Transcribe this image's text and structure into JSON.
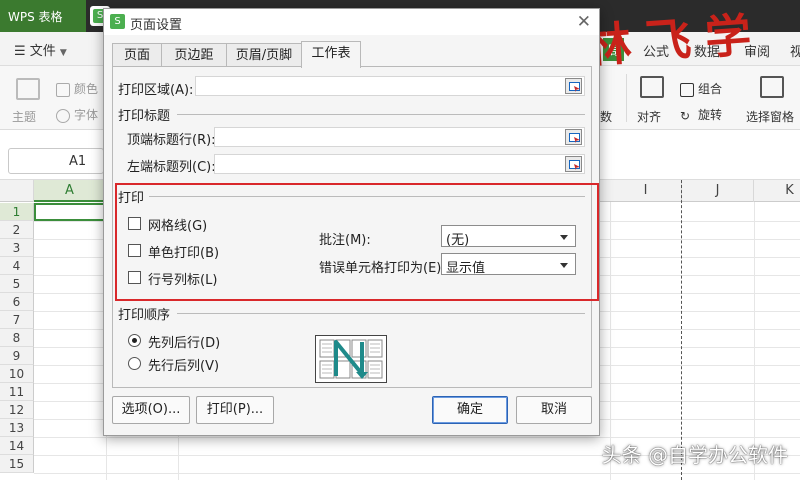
{
  "app": {
    "tab_title": "WPS 表格",
    "menu_label": "文件",
    "ribbon_tabs": [
      {
        "label": "局",
        "active": true
      },
      {
        "label": "公式"
      },
      {
        "label": "数据"
      },
      {
        "label": "审阅"
      },
      {
        "label": "视"
      }
    ],
    "ribbon_left": [
      {
        "label": "颜色"
      },
      {
        "label": "主题"
      },
      {
        "label": "字体"
      }
    ],
    "ribbon_right": [
      {
        "label": "组合"
      },
      {
        "label": "对齐"
      },
      {
        "label": "旋转"
      },
      {
        "label": "选择窗格"
      },
      {
        "label": "数"
      }
    ],
    "name_box": "A1",
    "columns": [
      "A",
      "I",
      "J",
      "K"
    ],
    "rows": [
      "1",
      "2",
      "3",
      "4",
      "5",
      "6",
      "7",
      "8",
      "9",
      "10",
      "11",
      "12",
      "13",
      "14",
      "15"
    ]
  },
  "overlay": {
    "calligraphy": "林飞学",
    "watermark": "头条 @自学办公软件"
  },
  "dialog": {
    "title": "页面设置",
    "tabs": [
      {
        "label": "页面"
      },
      {
        "label": "页边距"
      },
      {
        "label": "页眉/页脚"
      },
      {
        "label": "工作表",
        "active": true
      }
    ],
    "print_area_label": "打印区域(A):",
    "print_area_value": "",
    "print_titles": {
      "section": "打印标题",
      "top_rows_label": "顶端标题行(R):",
      "top_rows_value": "",
      "left_cols_label": "左端标题列(C):",
      "left_cols_value": ""
    },
    "print": {
      "section": "打印",
      "gridlines_label": "网格线(G)",
      "gridlines_checked": false,
      "mono_label": "单色打印(B)",
      "mono_checked": false,
      "headings_label": "行号列标(L)",
      "headings_checked": false,
      "comments_label": "批注(M):",
      "comments_value": "(无)",
      "errors_label": "错误单元格打印为(E):",
      "errors_value": "显示值"
    },
    "order": {
      "section": "打印顺序",
      "down_then_over_label": "先列后行(D)",
      "down_then_over_selected": true,
      "over_then_down_label": "先行后列(V)",
      "over_then_down_selected": false
    },
    "buttons": {
      "options": "选项(O)...",
      "print": "打印(P)...",
      "ok": "确定",
      "cancel": "取消"
    }
  },
  "colors": {
    "highlight_box": "#d9282b",
    "wps_green": "#3b8e3b",
    "calligraphy": "#c9221a"
  }
}
